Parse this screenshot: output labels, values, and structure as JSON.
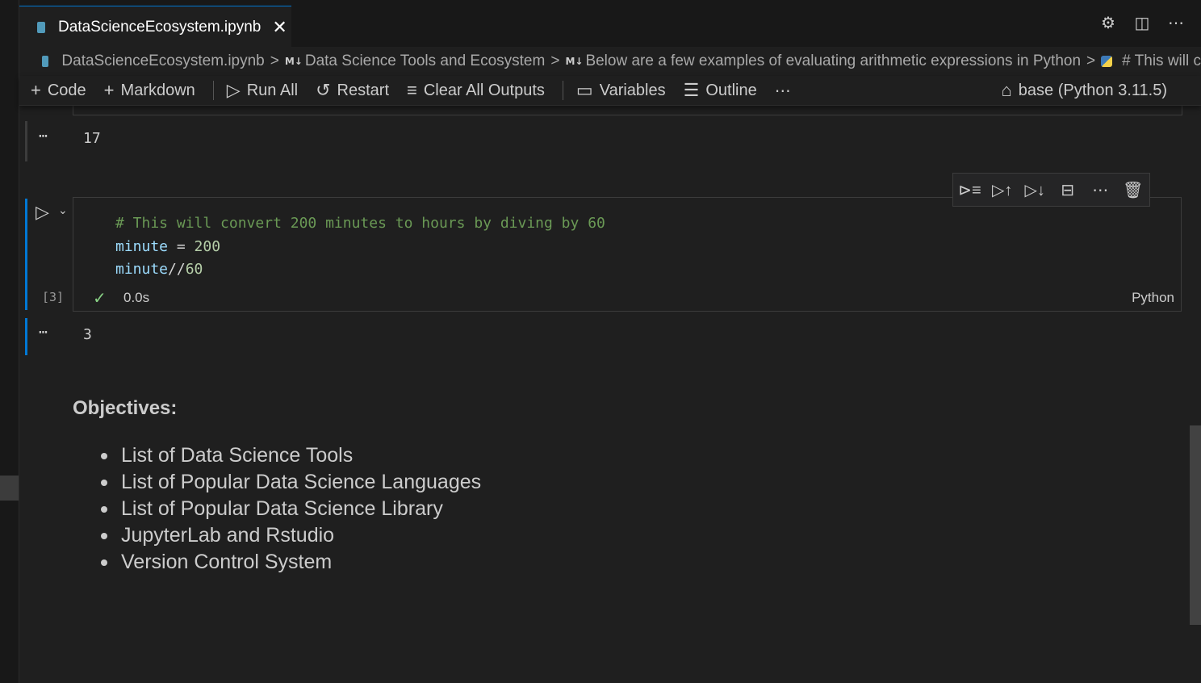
{
  "tab": {
    "label": "DataScienceEcosystem.ipynb",
    "close": "✕"
  },
  "tab_actions": {
    "settings_icon": "⚙",
    "split_icon": "◫",
    "more_icon": "⋯"
  },
  "breadcrumbs": {
    "file": "DataScienceEcosystem.ipynb",
    "md_badge": "M↓",
    "section1": "Data Science Tools and Ecosystem",
    "section2": "Below are a few examples of evaluating arithmetic expressions in Python",
    "cell": "# This will c",
    "separator": ">"
  },
  "toolbar": {
    "code": "Code",
    "markdown": "Markdown",
    "run_all": "Run All",
    "restart": "Restart",
    "clear_outputs": "Clear All Outputs",
    "variables": "Variables",
    "outline": "Outline",
    "more": "⋯",
    "kernel": "base (Python 3.11.5)"
  },
  "prev_output": {
    "dots": "⋯",
    "value": "17"
  },
  "cell_toolbar": {
    "execute_above": "⊳≡",
    "run_above": "▷↑",
    "run_below": "▷↓",
    "split": "⊟",
    "more": "⋯",
    "delete": "🗑"
  },
  "code_cell": {
    "line1": "# This will convert 200 minutes to hours by diving by 60",
    "line2_var": "minute",
    "line2_op": " = ",
    "line2_num": "200",
    "line3_var": "minute",
    "line3_op": "//",
    "line3_num": "60",
    "exec_count": "[3]",
    "check": "✓",
    "duration": "0.0s",
    "language": "Python"
  },
  "output": {
    "dots": "⋯",
    "value": "3"
  },
  "markdown": {
    "title": "Objectives:",
    "items": [
      "List of Data Science Tools",
      "List of Popular Data Science Languages",
      "List of Popular Data Science Library",
      "JupyterLab and Rstudio",
      "Version Control System"
    ]
  },
  "colors": {
    "accent": "#0078d4",
    "background": "#1f1f1f",
    "comment": "#6a9955",
    "variable": "#9cdcfe",
    "number": "#b5cea8",
    "success": "#89d185"
  }
}
